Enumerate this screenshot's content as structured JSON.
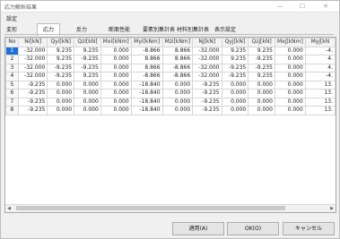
{
  "window": {
    "title": "応力解析結果",
    "minimize": "—",
    "maximize": "☐",
    "close": "✕"
  },
  "menu": {
    "settings": "設定"
  },
  "tabs": [
    "変形",
    "応力",
    "反力",
    "断面性能",
    "要素別集計表",
    "材料別集計表",
    "表示設定"
  ],
  "active_tab": 1,
  "table": {
    "columns": [
      "No",
      "Ni[kN]",
      "Qyi[kN]",
      "Qzi[kN]",
      "Mxi[kNm]",
      "Myi[kNm]",
      "Mzi[kNm]",
      "Nj[kN]",
      "Qyj[kN]",
      "Qzj[kN]",
      "Mxj[kNm]",
      "Myj[kN"
    ],
    "rows": [
      [
        "1",
        "-32.000",
        "9.235",
        "9.235",
        "0.000",
        "-8.866",
        "8.866",
        "-32.000",
        "9.235",
        "9.235",
        "0.000",
        "-4."
      ],
      [
        "2",
        "-32.000",
        "9.235",
        "-9.235",
        "0.000",
        "8.866",
        "8.866",
        "-32.000",
        "9.235",
        "-9.235",
        "0.000",
        "4."
      ],
      [
        "3",
        "-32.000",
        "-9.235",
        "-9.235",
        "0.000",
        "8.866",
        "-8.866",
        "-32.000",
        "-9.235",
        "-9.235",
        "0.000",
        "4."
      ],
      [
        "4",
        "-32.000",
        "-9.235",
        "9.235",
        "0.000",
        "-8.866",
        "-8.866",
        "-32.000",
        "-9.235",
        "9.235",
        "0.000",
        "-4."
      ],
      [
        "5",
        "-9.235",
        "0.000",
        "0.000",
        "0.000",
        "-18.840",
        "0.000",
        "-9.235",
        "0.000",
        "0.000",
        "0.000",
        "13."
      ],
      [
        "6",
        "-9.235",
        "0.000",
        "0.000",
        "0.000",
        "-18.840",
        "0.000",
        "-9.235",
        "0.000",
        "0.000",
        "0.000",
        "13."
      ],
      [
        "7",
        "-9.235",
        "0.000",
        "0.000",
        "0.000",
        "-18.840",
        "0.000",
        "-9.235",
        "0.000",
        "0.000",
        "0.000",
        "13."
      ],
      [
        "8",
        "-9.235",
        "0.000",
        "0.000",
        "0.000",
        "-18.840",
        "0.000",
        "-9.235",
        "0.000",
        "0.000",
        "0.000",
        "13."
      ]
    ],
    "selected_row": 0
  },
  "scrollbar": {
    "left_arrow": "◀",
    "right_arrow": "▶"
  },
  "buttons": {
    "apply": "適用(A)",
    "ok": "OK(O)",
    "cancel": "キャンセル"
  }
}
